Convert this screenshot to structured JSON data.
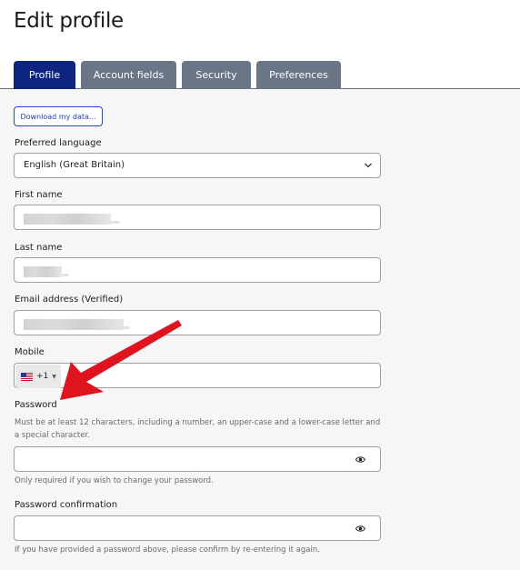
{
  "page": {
    "title": "Edit profile"
  },
  "tabs": [
    {
      "label": "Profile",
      "active": true
    },
    {
      "label": "Account fields",
      "active": false
    },
    {
      "label": "Security",
      "active": false
    },
    {
      "label": "Preferences",
      "active": false
    }
  ],
  "download_button": "Download my data...",
  "fields": {
    "language": {
      "label": "Preferred language",
      "value": "English (Great Britain)"
    },
    "first_name": {
      "label": "First name",
      "value": ""
    },
    "last_name": {
      "label": "Last name",
      "value": ""
    },
    "email": {
      "label": "Email address (Verified)",
      "value": ""
    },
    "mobile": {
      "label": "Mobile",
      "country_code": "+1",
      "value": ""
    },
    "password": {
      "label": "Password",
      "requirements": "Must be at least 12 characters, including a number, an upper-case and a lower-case letter and a special character.",
      "value": "",
      "help": "Only required if you wish to change your password."
    },
    "password_confirmation": {
      "label": "Password confirmation",
      "value": "",
      "help": "If you have provided a password above, please confirm by re-entering it again."
    }
  },
  "icons": {
    "select_chevron": "chevron-down-icon",
    "show_password": "eye-icon",
    "country_flag": "us-flag-icon",
    "annotation": "red-arrow"
  },
  "colors": {
    "tab_active": "#0d2481",
    "tab_inactive": "#6a7686",
    "link_blue": "#1f3cbd",
    "arrow_red": "#e0141e"
  }
}
